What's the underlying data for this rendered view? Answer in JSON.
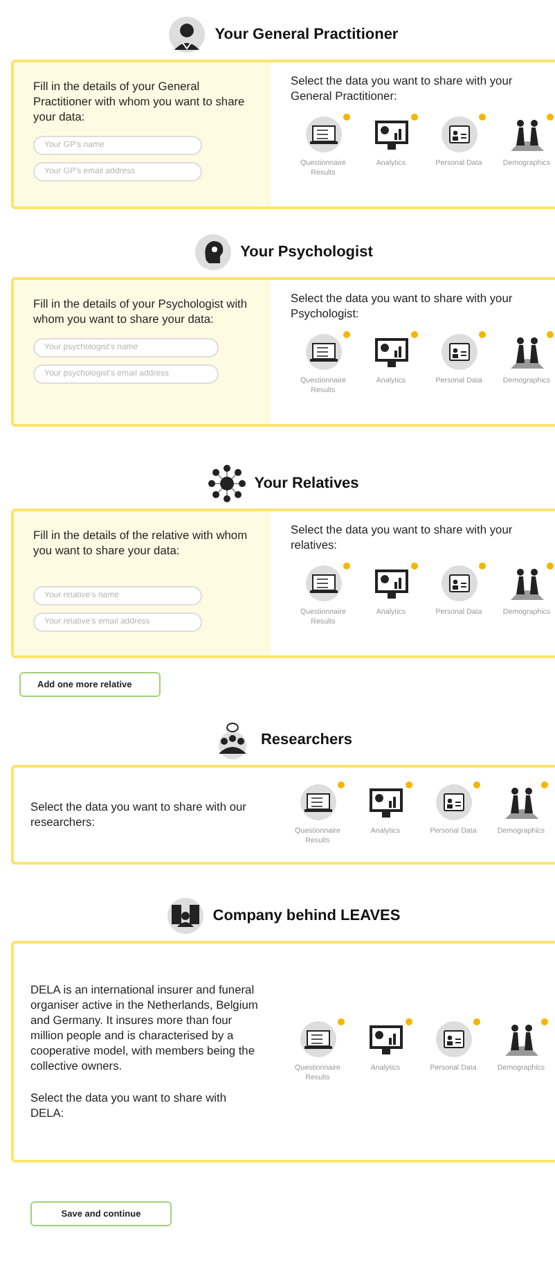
{
  "sections": [
    {
      "kind": "gp",
      "title": "Your General Practitioner",
      "form": {
        "intro": "Fill in the details of your General Practitioner with whom you want to share your data:",
        "fields": [
          {
            "placeholder": "Your GP's name"
          },
          {
            "placeholder": "Your GP's email address"
          }
        ]
      },
      "prompt": "Select the data you want to share with your General Practitioner:",
      "options": [
        {
          "kind": "questionnaire",
          "label": "Questionnaire Results"
        },
        {
          "kind": "analytics",
          "label": "Analytics"
        },
        {
          "kind": "personal",
          "label": "Personal Data"
        },
        {
          "kind": "demographics",
          "label": "Demographics"
        }
      ]
    },
    {
      "kind": "psychologist",
      "title": "Your Psychologist",
      "form": {
        "intro": "Fill in the details of your Psychologist with whom you want to share your data:",
        "fields": [
          {
            "placeholder": "Your psychologist's name"
          },
          {
            "placeholder": "Your psychologist's email address"
          }
        ]
      },
      "prompt": "Select the data you want to share with your Psychologist:",
      "options": [
        {
          "kind": "questionnaire",
          "label": "Questionnaire Results"
        },
        {
          "kind": "analytics",
          "label": "Analytics"
        },
        {
          "kind": "personal",
          "label": "Personal Data"
        },
        {
          "kind": "demographics",
          "label": "Demographics"
        }
      ]
    },
    {
      "kind": "relatives",
      "title": "Your Relatives",
      "form": {
        "intro": "Fill in the details of the relative with whom you want to share your data:",
        "fields": [
          {
            "placeholder": "Your relative's name"
          },
          {
            "placeholder": "Your relative's email address"
          }
        ]
      },
      "prompt": "Select the data you want to share with your relatives:",
      "options": [
        {
          "kind": "questionnaire",
          "label": "Questionnaire Results"
        },
        {
          "kind": "analytics",
          "label": "Analytics"
        },
        {
          "kind": "personal",
          "label": "Personal Data"
        },
        {
          "kind": "demographics",
          "label": "Demographics"
        }
      ],
      "button": "Add one more relative"
    },
    {
      "kind": "researchers",
      "title": "Researchers",
      "text": [
        "Select the data you want to share with our researchers:"
      ],
      "options": [
        {
          "kind": "questionnaire",
          "label": "Questionnaire Results"
        },
        {
          "kind": "analytics",
          "label": "Analytics"
        },
        {
          "kind": "personal",
          "label": "Personal Data"
        },
        {
          "kind": "demographics",
          "label": "Demographics"
        }
      ]
    },
    {
      "kind": "company",
      "title": "Company behind LEAVES",
      "text": [
        "DELA is an international insurer and funeral organiser active in the Netherlands, Belgium and Germany. It insures more than four million people and is characterised by a cooperative model, with members being the collective owners.",
        "Select the data you want to share with DELA:"
      ],
      "options": [
        {
          "kind": "questionnaire",
          "label": "Questionnaire Results"
        },
        {
          "kind": "analytics",
          "label": "Analytics"
        },
        {
          "kind": "personal",
          "label": "Personal Data"
        },
        {
          "kind": "demographics",
          "label": "Demographics"
        }
      ]
    }
  ],
  "save_button": "Save and continue"
}
